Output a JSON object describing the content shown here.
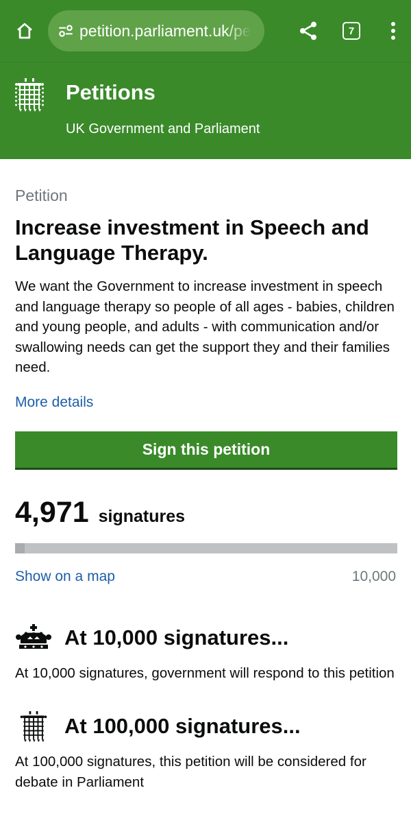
{
  "browser": {
    "url": "petition.parliament.uk/pe",
    "tab_count": "7",
    "colors": {
      "bar": "#3a8a2a",
      "url_pill": "#5fa248"
    },
    "icons": [
      "home-icon",
      "tune-icon",
      "share-icon",
      "tabs-icon",
      "more-vert-icon"
    ]
  },
  "header": {
    "title": "Petitions",
    "subtitle": "UK Government and Parliament",
    "logo_icon": "portcullis-icon"
  },
  "petition": {
    "label": "Petition",
    "title": "Increase investment in Speech and Language Therapy.",
    "description": "We want the Government to increase investment in speech and language therapy so people of all ages - babies, children and young people, and adults - with communication and/or swallowing needs can get the support they and their families need.",
    "more_details": "More details",
    "sign_button": "Sign this petition"
  },
  "signatures": {
    "count": "4,971",
    "label": "signatures",
    "progress_percent": 2.5,
    "show_map": "Show on a map",
    "goal": "10,000"
  },
  "thresholds": [
    {
      "icon": "crown-icon",
      "title": "At 10,000 signatures...",
      "text": "At 10,000 signatures, government will respond to this petition"
    },
    {
      "icon": "portcullis-icon",
      "title": "At 100,000 signatures...",
      "text": "At 100,000 signatures, this petition will be considered for debate in Parliament"
    }
  ],
  "colors": {
    "brand_green": "#3a8a2a",
    "link_blue": "#1d5ea8",
    "muted_grey": "#6f777b",
    "progress_track": "#bfc1c3"
  }
}
